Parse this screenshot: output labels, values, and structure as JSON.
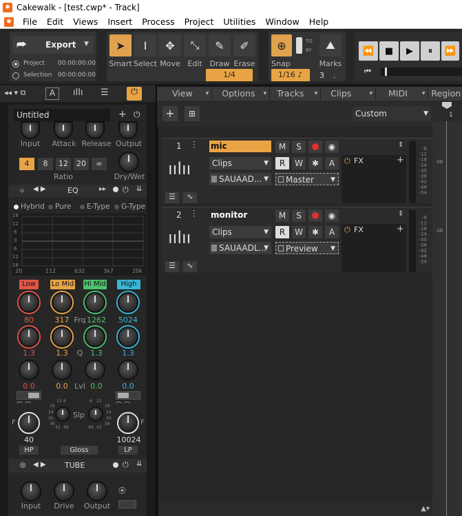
{
  "window": {
    "title": "Cakewalk - [test.cwp* - Track]"
  },
  "menu": [
    "File",
    "Edit",
    "Views",
    "Insert",
    "Process",
    "Project",
    "Utilities",
    "Window",
    "Help"
  ],
  "export": {
    "label": "Export",
    "project_label": "Project",
    "selection_label": "Selection",
    "project_time": "00:00:00:00",
    "selection_time": "00:00:00:00"
  },
  "tools": {
    "smart": "Smart",
    "select": "Select",
    "move": "Move",
    "edit": "Edit",
    "draw": "Draw",
    "erase": "Erase",
    "draw_value": "1/4"
  },
  "snap": {
    "label": "Snap",
    "value": "1/16",
    "to": "TO",
    "by": "BY",
    "marks": "Marks",
    "num": "3",
    "dot": "."
  },
  "track_toolbar": [
    "View",
    "Options",
    "Tracks",
    "Clips",
    "MIDI",
    "Region"
  ],
  "custom_select": "Custom",
  "ruler_marker": "1",
  "prochannel": {
    "preset_name": "Untitled",
    "comp_labels": {
      "input": "Input",
      "attack": "Attack",
      "release": "Release",
      "output": "Output",
      "ratio": "Ratio",
      "drywet": "Dry/Wet"
    },
    "ratios": [
      "4",
      "8",
      "12",
      "20",
      "∞"
    ],
    "eq": {
      "title": "EQ",
      "modes": [
        "Hybrid",
        "Pure",
        "E-Type",
        "G-Type"
      ],
      "grid_y": [
        "18",
        "12",
        "6",
        "0",
        "6",
        "12",
        "18"
      ],
      "grid_x": [
        "20",
        "112",
        "632",
        "3k7",
        "20k"
      ],
      "bands": [
        {
          "name": "Low",
          "freq": "80",
          "q": "1.3",
          "lvl": "0.0",
          "color": "#e25545"
        },
        {
          "name": "Lo Mid",
          "freq": "317",
          "q": "1.3",
          "lvl": "0.0",
          "color": "#e8a444"
        },
        {
          "name": "Hi Mid",
          "freq": "1262",
          "q": "1.3",
          "lvl": "0.0",
          "color": "#4cc26a"
        },
        {
          "name": "High",
          "freq": "5024",
          "q": "1.3",
          "lvl": "0.0",
          "color": "#3bb5d8"
        }
      ],
      "row_labels": {
        "frq": "Frq",
        "q": "Q",
        "lvl": "Lvl",
        "slp": "Slp"
      },
      "slp_scale": [
        "12",
        "6",
        "18",
        "24",
        "30",
        "36",
        "42",
        "48"
      ],
      "hp": {
        "label": "HP",
        "value": "40",
        "f": "F"
      },
      "lp": {
        "label": "LP",
        "value": "10024",
        "f": "F"
      },
      "gloss": "Gloss"
    },
    "tube": {
      "title": "TUBE",
      "labels": [
        "Input",
        "Drive",
        "Output"
      ]
    }
  },
  "tracks": [
    {
      "num": "1",
      "name": "mic",
      "m": "M",
      "s": "S",
      "r": "R",
      "w": "W",
      "a": "A",
      "clips": "Clips",
      "input": "SAUAAD...",
      "output": "Master",
      "fx": "FX",
      "name_bg": "#e8a444"
    },
    {
      "num": "2",
      "name": "monitor",
      "m": "M",
      "s": "S",
      "r": "R",
      "w": "W",
      "a": "A",
      "clips": "Clips",
      "input": "SAUAADL...",
      "output": "Preview",
      "fx": "FX",
      "name_bg": "#2b2b2b"
    }
  ],
  "meter_scale": [
    "-6",
    "-12",
    "-18",
    "-24",
    "-30",
    "-36",
    "-42",
    "-48",
    "-54"
  ],
  "meter_unit": "dB"
}
